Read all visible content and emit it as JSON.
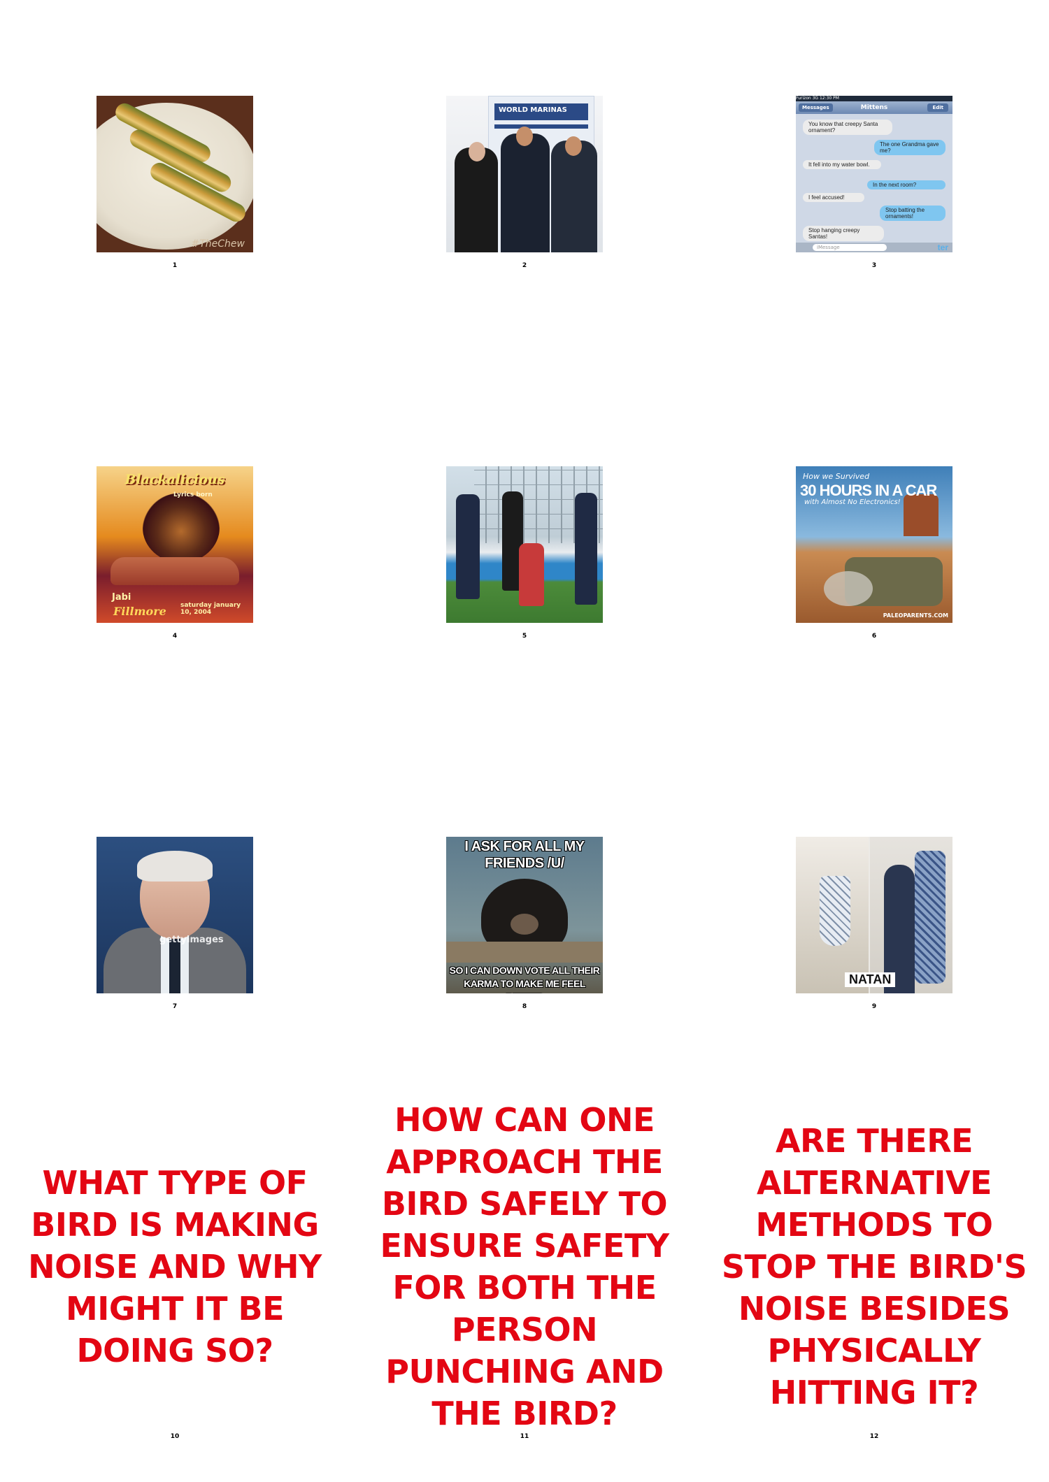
{
  "cells": [
    {
      "number": "1",
      "watermark": "#TheChew"
    },
    {
      "number": "2",
      "banner_title": "WORLD MARINAS"
    },
    {
      "number": "3",
      "status": "Furizon 3G   12:30 PM",
      "nav_back": "Messages",
      "nav_title": "Mittens",
      "nav_edit": "Edit",
      "messages": [
        {
          "side": "in",
          "text": "You know that creepy Santa ornament?"
        },
        {
          "side": "out",
          "text": "The one Grandma gave me?"
        },
        {
          "side": "in",
          "text": "It fell into my water bowl."
        },
        {
          "side": "out",
          "text": "In the next room?"
        },
        {
          "side": "in",
          "text": "I feel accused!"
        },
        {
          "side": "out",
          "text": "Stop batting the ornaments!"
        },
        {
          "side": "in",
          "text": "Stop hanging creepy Santas!"
        }
      ],
      "input_placeholder": "iMessage",
      "watermark": "ter"
    },
    {
      "number": "4",
      "title": "Blackalicious",
      "subtitle": "Lyrics born",
      "line1": "Jabi",
      "line2": "Fillmore",
      "date": "saturday january 10, 2004"
    },
    {
      "number": "5"
    },
    {
      "number": "6",
      "line1": "How we Survived",
      "line2": "30 HOURS IN A CAR",
      "line3": "with Almost No Electronics!",
      "watermark": "PALEOPARENTS.COM"
    },
    {
      "number": "7",
      "watermark": "gettyimages"
    },
    {
      "number": "8",
      "top_text": "I ASK FOR ALL MY FRIENDS /U/",
      "bottom_text": "SO I CAN DOWN VOTE ALL THEIR KARMA TO MAKE ME FEEL BETTER"
    },
    {
      "number": "9",
      "label": "NATAN"
    }
  ],
  "questions": [
    {
      "number": "10",
      "text": "WHAT TYPE OF BIRD IS MAKING NOISE AND WHY MIGHT IT BE DOING SO?"
    },
    {
      "number": "11",
      "text": "HOW CAN ONE APPROACH THE BIRD SAFELY TO ENSURE SAFETY FOR BOTH THE PERSON PUNCHING AND THE BIRD?"
    },
    {
      "number": "12",
      "text": "ARE THERE ALTERNATIVE METHODS TO STOP THE BIRD'S NOISE BESIDES PHYSICALLY HITTING IT?"
    }
  ]
}
